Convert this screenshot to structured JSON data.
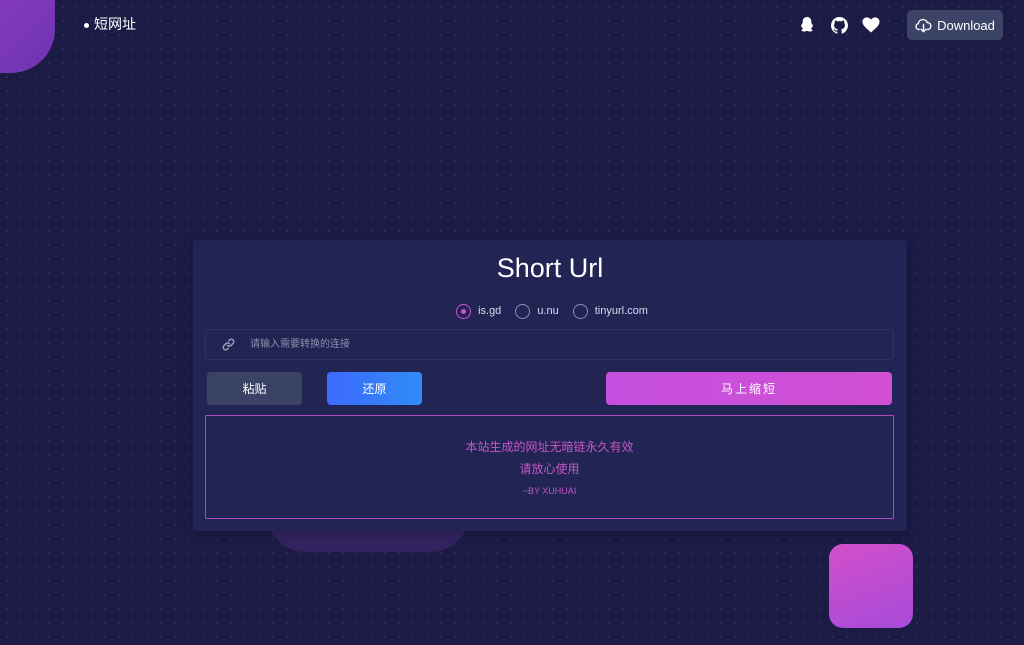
{
  "header": {
    "brand": "短网址",
    "icons": [
      "qq-icon",
      "github-icon",
      "heart-icon"
    ],
    "download_label": "Download"
  },
  "card": {
    "title": "Short Url",
    "providers": [
      {
        "label": "is.gd",
        "checked": true
      },
      {
        "label": "u.nu",
        "checked": false
      },
      {
        "label": "tinyurl.com",
        "checked": false
      }
    ],
    "url_input": {
      "placeholder": "请输入需要转换的连接",
      "value": ""
    },
    "buttons": {
      "paste": "粘贴",
      "restore": "还原",
      "shorten": "马上缩短"
    },
    "notice": {
      "line1": "本站生成的网址无暗链永久有效",
      "line2": "请放心使用",
      "signature": "~BY XUHUAI"
    }
  },
  "colors": {
    "background": "#1b1b46",
    "card": "#222553",
    "accent_pink": "#d34fd0",
    "accent_blue": "#3d6aff",
    "notice_text": "#c356c6"
  }
}
